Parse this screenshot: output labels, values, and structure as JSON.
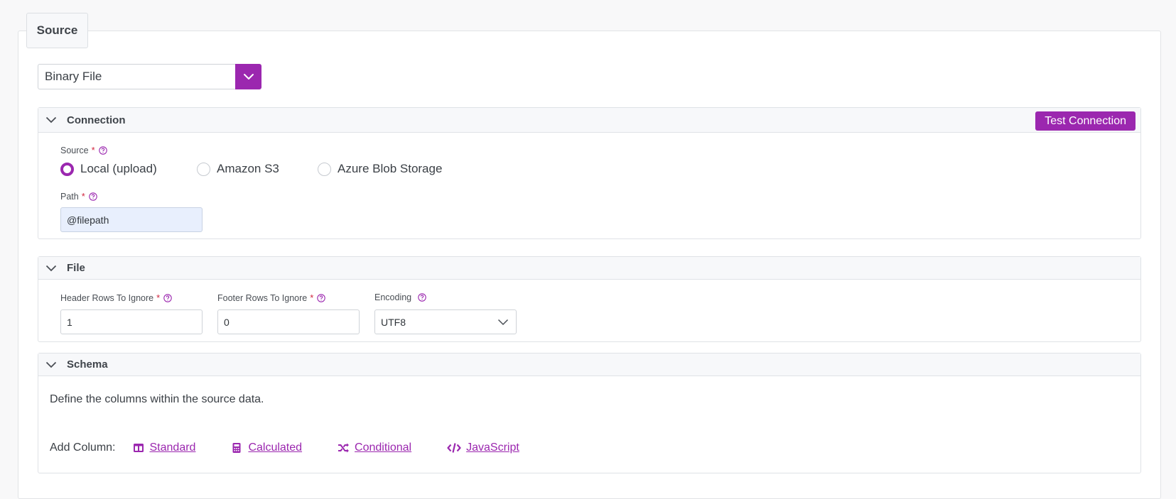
{
  "source_section": {
    "legend": "Source",
    "type_select": {
      "value": "Binary File"
    }
  },
  "connection": {
    "title": "Connection",
    "test_button": "Test Connection",
    "source_field": {
      "label": "Source",
      "required": "*",
      "options": [
        {
          "label": "Local (upload)",
          "checked": true
        },
        {
          "label": "Amazon S3",
          "checked": false
        },
        {
          "label": "Azure Blob Storage",
          "checked": false
        }
      ]
    },
    "path_field": {
      "label": "Path",
      "required": "*",
      "value": "@filepath"
    }
  },
  "file": {
    "title": "File",
    "header_rows": {
      "label": "Header Rows To Ignore",
      "required": "*",
      "value": "1"
    },
    "footer_rows": {
      "label": "Footer Rows To Ignore",
      "required": "*",
      "value": "0"
    },
    "encoding": {
      "label": "Encoding",
      "value": "UTF8"
    }
  },
  "schema": {
    "title": "Schema",
    "description": "Define the columns within the source data.",
    "add_column_label": "Add Column:",
    "links": [
      {
        "label": "Standard",
        "icon": "columns-icon"
      },
      {
        "label": "Calculated",
        "icon": "calculator-icon"
      },
      {
        "label": "Conditional",
        "icon": "shuffle-icon"
      },
      {
        "label": "JavaScript",
        "icon": "code-icon"
      }
    ]
  },
  "colors": {
    "accent": "#9b27af",
    "required": "#d0263e",
    "filled_input_bg": "#e8effd"
  }
}
